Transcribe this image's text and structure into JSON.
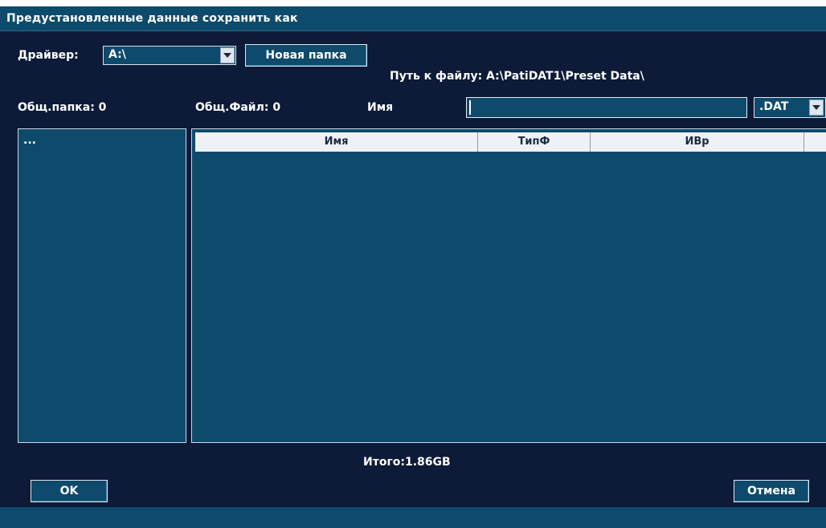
{
  "window": {
    "title": "Предустановленные данные сохранить как"
  },
  "toolbar": {
    "driver_label": "Драйвер:",
    "driver_value": "A:\\",
    "new_folder_label": "Новая папка",
    "path_text": "Путь к файлу: A:\\PatiDAT1\\Preset Data\\"
  },
  "info": {
    "total_folders": "Общ.папка: 0",
    "total_files": "Общ.Файл: 0",
    "name_label": "Имя",
    "name_value": "",
    "extension_value": ".DAT"
  },
  "folder_tree": {
    "items": [
      "..."
    ]
  },
  "file_table": {
    "columns": [
      "Имя",
      "ТипФ",
      "ИВр"
    ],
    "rows": []
  },
  "summary": {
    "total": "Итого:1.86GB"
  },
  "footer": {
    "ok_label": "OK",
    "cancel_label": "Отмена"
  },
  "colors": {
    "background": "#0d1b38",
    "panel": "#0e4a6b",
    "border": "#c9d8e4",
    "header": "#eef1f5"
  },
  "icons": {
    "dropdown": "chevron-down-icon"
  }
}
